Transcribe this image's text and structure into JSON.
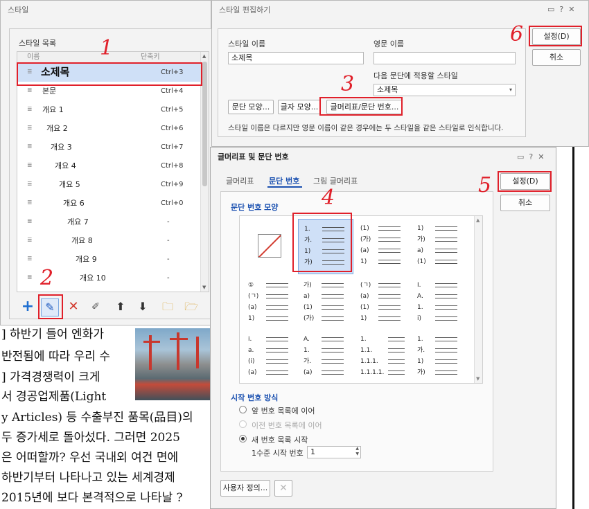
{
  "style_window": {
    "title": "스타일",
    "group_label": "스타일 목록",
    "col_name": "이름",
    "col_shortcut": "단축키",
    "items": [
      {
        "label": "소제목",
        "shortcut": "Ctrl+3"
      },
      {
        "label": "본문",
        "shortcut": "Ctrl+4"
      },
      {
        "label": "개요 1",
        "shortcut": "Ctrl+5"
      },
      {
        "label": "개요 2",
        "shortcut": "Ctrl+6"
      },
      {
        "label": "개요 3",
        "shortcut": "Ctrl+7"
      },
      {
        "label": "개요 4",
        "shortcut": "Ctrl+8"
      },
      {
        "label": "개요 5",
        "shortcut": "Ctrl+9"
      },
      {
        "label": "개요 6",
        "shortcut": "Ctrl+0"
      },
      {
        "label": "개요 7",
        "shortcut": "-"
      },
      {
        "label": "개요 8",
        "shortcut": "-"
      },
      {
        "label": "개요 9",
        "shortcut": "-"
      },
      {
        "label": "개요 10",
        "shortcut": "-"
      }
    ]
  },
  "edit_dialog": {
    "title": "스타일 편집하기",
    "style_name_label": "스타일 이름",
    "style_name_value": "소제목",
    "english_name_label": "영문 이름",
    "english_name_value": "",
    "next_style_label": "다음 문단에 적용할 스타일",
    "next_style_value": "소제목",
    "btn_para_shape": "문단 모양...",
    "btn_char_shape": "글자 모양...",
    "btn_bullet_number": "글머리표/문단 번호...",
    "note": "스타일 이름은 다르지만 영문 이름이 같은 경우에는 두 스타일을 같은 스타일로 인식합니다.",
    "btn_ok": "설정(D)",
    "btn_cancel": "취소"
  },
  "numbering_dialog": {
    "title": "글머리표 및 문단 번호",
    "tabs": [
      "글머리표",
      "문단 번호",
      "그림 글머리표"
    ],
    "section_shape": "문단 번호 모양",
    "presets": [
      [],
      [
        "1.",
        "가.",
        "1)",
        "가)"
      ],
      [
        "(1)",
        "(가)",
        "(a)",
        "1)"
      ],
      [
        "1)",
        "가)",
        "a)",
        "(1)"
      ],
      [
        "①",
        "(ㄱ)",
        "(a)",
        "1)"
      ],
      [
        "가)",
        "a)",
        "(1)",
        "(가)"
      ],
      [
        "(ㄱ)",
        "(a)",
        "(1)",
        "1)"
      ],
      [
        "I.",
        "A.",
        "1.",
        "i)"
      ],
      [
        "i.",
        "a.",
        "(i)",
        "(a)"
      ],
      [
        "A.",
        "1.",
        "가.",
        "(a)"
      ],
      [
        "1.",
        "1.1.",
        "1.1.1.",
        "1.1.1.1."
      ],
      [
        "1.",
        "가.",
        "1)",
        "가)"
      ]
    ],
    "section_start": "시작 번호 방식",
    "radio_continue_prev": "앞 번호 목록에 이어",
    "radio_continue_before": "이전 번호 목록에 이어",
    "radio_new_list": "새 번호 목록 시작",
    "start_level_label": "1수준 시작 번호",
    "start_level_value": "1",
    "btn_custom": "사용자 정의...",
    "btn_ok": "설정(D)",
    "btn_cancel": "취소"
  },
  "document": {
    "lines": [
      "] 하반기 들어 엔화가",
      "반전됨에 따라 우리 수",
      "] 가격경쟁력이 크게",
      "서 경공업제품(Light",
      "y Articles) 등 수출부진 품목(品目)의",
      "두 증가세로 돌아섰다. 그러면 2025",
      "은 어떠할까? 우선 국내외 여건 면에",
      " 하반기부터 나타나고 있는 세계경제",
      "2015년에 보다 본격적으로 나타날 ?"
    ]
  },
  "annotations": [
    "1",
    "2",
    "3",
    "4",
    "5",
    "6"
  ],
  "colors": {
    "highlight": "#e0202a",
    "selection": "#cfe0f7",
    "accent": "#1a50b0"
  }
}
